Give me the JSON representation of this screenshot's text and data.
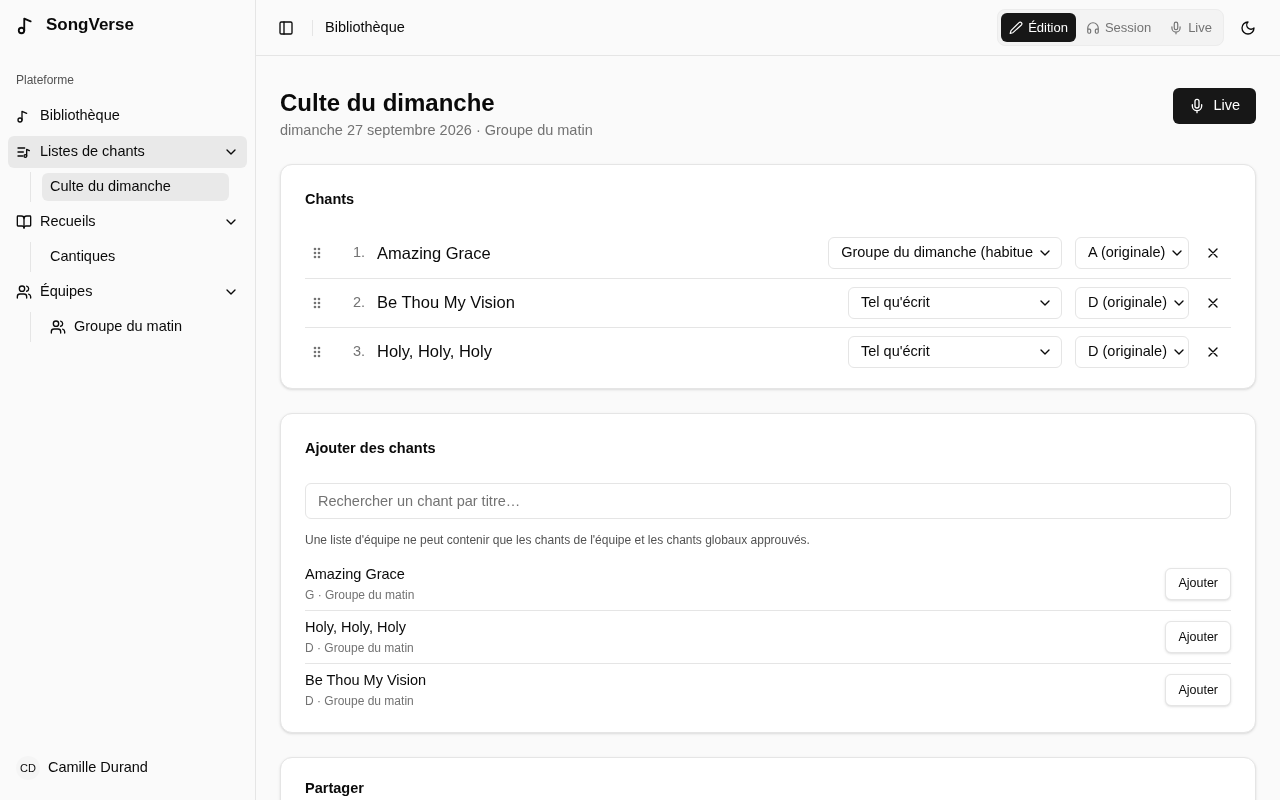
{
  "sidebar": {
    "brand": "SongVerse",
    "section_label": "Plateforme",
    "items": [
      {
        "label": "Bibliothèque",
        "selected": false
      },
      {
        "label": "Listes de chants",
        "selected": true,
        "expanded": true,
        "children": [
          {
            "label": "Culte du dimanche",
            "selected": true
          }
        ]
      },
      {
        "label": "Recueils",
        "selected": false,
        "expanded": true,
        "children": [
          {
            "label": "Cantiques",
            "selected": false
          }
        ]
      },
      {
        "label": "Équipes",
        "selected": false,
        "expanded": true,
        "children": [
          {
            "label": "Groupe du matin",
            "selected": false
          }
        ]
      }
    ],
    "user": {
      "initials": "CD",
      "name": "Camille Durand"
    }
  },
  "header": {
    "breadcrumb": "Bibliothèque",
    "modes": [
      {
        "label": "Édition",
        "selected": true
      },
      {
        "label": "Session",
        "selected": false
      },
      {
        "label": "Live",
        "selected": false
      }
    ]
  },
  "page": {
    "title": "Culte du dimanche",
    "subtitle": "dimanche 27 septembre 2026 · Groupe du matin",
    "live_button": "Live"
  },
  "setlist": {
    "title": "Chants",
    "songs": [
      {
        "number": "1.",
        "title": "Amazing Grace",
        "arrangement": "Groupe du dimanche (habitue",
        "key": "A (originale)"
      },
      {
        "number": "2.",
        "title": "Be Thou My Vision",
        "arrangement": "Tel qu'écrit",
        "key": "D (originale)"
      },
      {
        "number": "3.",
        "title": "Holy, Holy, Holy",
        "arrangement": "Tel qu'écrit",
        "key": "D (originale)"
      }
    ]
  },
  "add_songs": {
    "title": "Ajouter des chants",
    "search": {
      "placeholder": "Rechercher un chant par titre…"
    },
    "note": "Une liste d'équipe ne peut contenir que les chants de l'équipe et les chants globaux approuvés.",
    "results": [
      {
        "title": "Amazing Grace",
        "meta": "G · Groupe du matin",
        "button": "Ajouter"
      },
      {
        "title": "Holy, Holy, Holy",
        "meta": "D · Groupe du matin",
        "button": "Ajouter"
      },
      {
        "title": "Be Thou My Vision",
        "meta": "D · Groupe du matin",
        "button": "Ajouter"
      }
    ]
  },
  "share": {
    "title": "Partager"
  }
}
